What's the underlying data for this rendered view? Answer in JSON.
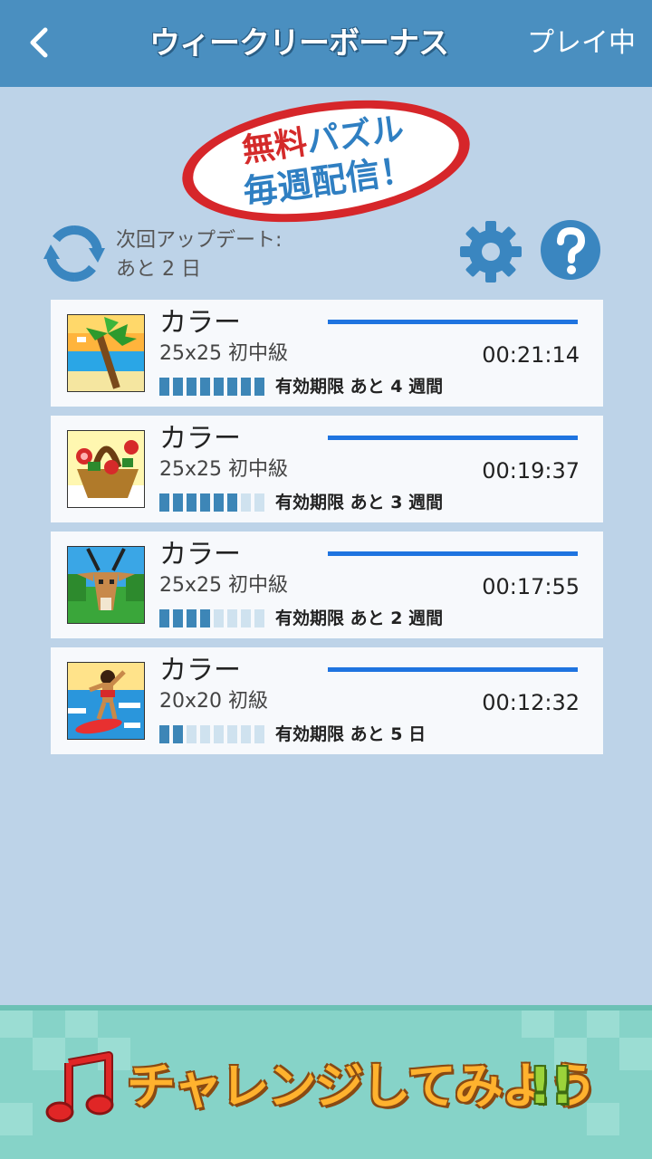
{
  "header": {
    "title": "ウィークリーボーナス",
    "right_label": "プレイ中",
    "back_icon": "chevron-left-icon"
  },
  "badge": {
    "line1_red": "無料",
    "line1_blue": "パズル",
    "line2": "毎週配信！"
  },
  "update": {
    "label": "次回アップデート:",
    "remaining": "あと 2 日"
  },
  "toolbar": {
    "settings_icon": "gear-icon",
    "help_icon": "question-icon"
  },
  "puzzles": [
    {
      "name": "カラー",
      "size": "25x25 初中級",
      "time": "00:21:14",
      "expiry": "有効期限 あと 4 週間",
      "remaining_segments": 8,
      "total_segments": 8
    },
    {
      "name": "カラー",
      "size": "25x25 初中級",
      "time": "00:19:37",
      "expiry": "有効期限 あと 3 週間",
      "remaining_segments": 6,
      "total_segments": 8
    },
    {
      "name": "カラー",
      "size": "25x25 初中級",
      "time": "00:17:55",
      "expiry": "有効期限 あと 2 週間",
      "remaining_segments": 4,
      "total_segments": 8
    },
    {
      "name": "カラー",
      "size": "20x20 初級",
      "time": "00:12:32",
      "expiry": "有効期限 あと 5 日",
      "remaining_segments": 2,
      "total_segments": 8
    }
  ],
  "banner": {
    "text": "チャレンジしてみよう",
    "exclaim": "!!",
    "icon": "music-note-icon"
  },
  "colors": {
    "header_bg": "#4a8fc0",
    "page_bg": "#bdd3e8",
    "progress_on": "#3d86b7",
    "progress_off": "#cfe2ef",
    "line_accent": "#1f74e0"
  }
}
